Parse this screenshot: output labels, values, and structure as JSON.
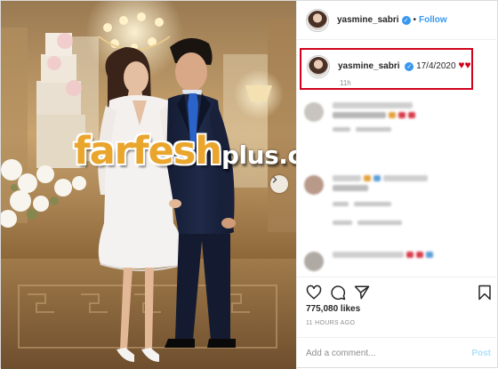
{
  "header": {
    "username": "yasmine_sabri",
    "verified_glyph": "✓",
    "separator": "•",
    "follow_label": "Follow"
  },
  "caption": {
    "username": "yasmine_sabri",
    "verified_glyph": "✓",
    "text": "17/4/2020",
    "emojis": "♥♥",
    "time": "11h",
    "highlight_color": "#d0021b"
  },
  "comments": [
    {
      "avatar_color": "#c9c4bf",
      "line_colors": [
        "#cfcfcf",
        "#b7b7b7"
      ],
      "accent_colors": [
        "#e3a23b",
        "#d83c4a",
        "#d83c4a"
      ]
    },
    {
      "avatar_color": "#b99a8a",
      "line_colors": [
        "#cfcfcf",
        "#bdbdbd"
      ],
      "accent_colors": [
        "#e3a23b",
        "#5a9fd6"
      ]
    },
    {
      "avatar_color": "#b0aaa4",
      "line_colors": [
        "#cfcfcf"
      ],
      "accent_colors": [
        "#d83c4a",
        "#d83c4a",
        "#5a9fd6"
      ]
    }
  ],
  "icons": {
    "like": "heart-outline-icon",
    "comment": "comment-bubble-icon",
    "share": "paper-plane-icon",
    "save": "bookmark-icon",
    "carousel": "chevron-right-icon"
  },
  "likes": "775,080 likes",
  "time_ago": "11 HOURS AGO",
  "add_comment": {
    "placeholder": "Add a comment...",
    "post_label": "Post"
  },
  "watermark": {
    "main": "farfesh",
    "suffix": "plus.com"
  },
  "colors": {
    "accent_blue": "#3897f0",
    "watermark_orange": "#e9a52c",
    "highlight_red": "#d0021b"
  }
}
